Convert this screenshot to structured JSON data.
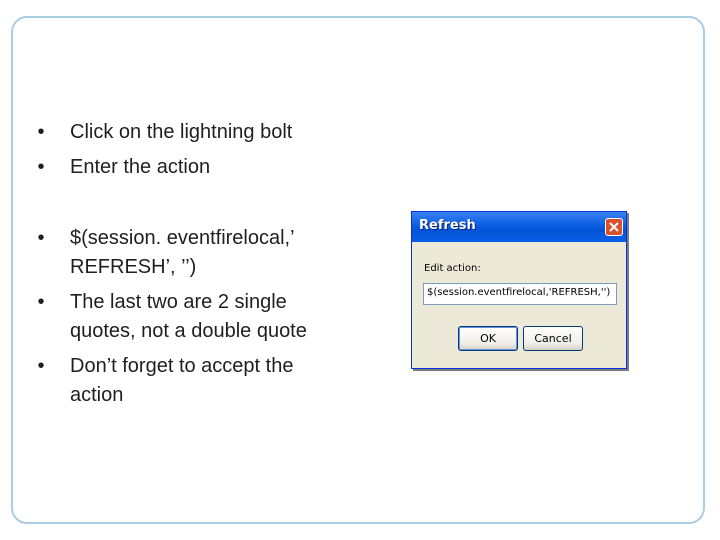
{
  "bullets_top": [
    "Click on the lightning bolt",
    "Enter the action"
  ],
  "bullets_bottom": [
    "$(session. eventfirelocal,’ REFRESH’, ’’)",
    "The last two are 2 single quotes, not a double quote",
    "Don’t forget to accept the action"
  ],
  "bullet_glyph": "•",
  "dialog": {
    "title": "Refresh",
    "field_label": "Edit action:",
    "field_value": "$(session.eventfirelocal,'REFRESH,'')",
    "ok_label": "OK",
    "cancel_label": "Cancel"
  },
  "colors": {
    "frame_border": "#a9cde3",
    "titlebar": "#0453d8",
    "close_button": "#d8502f"
  }
}
